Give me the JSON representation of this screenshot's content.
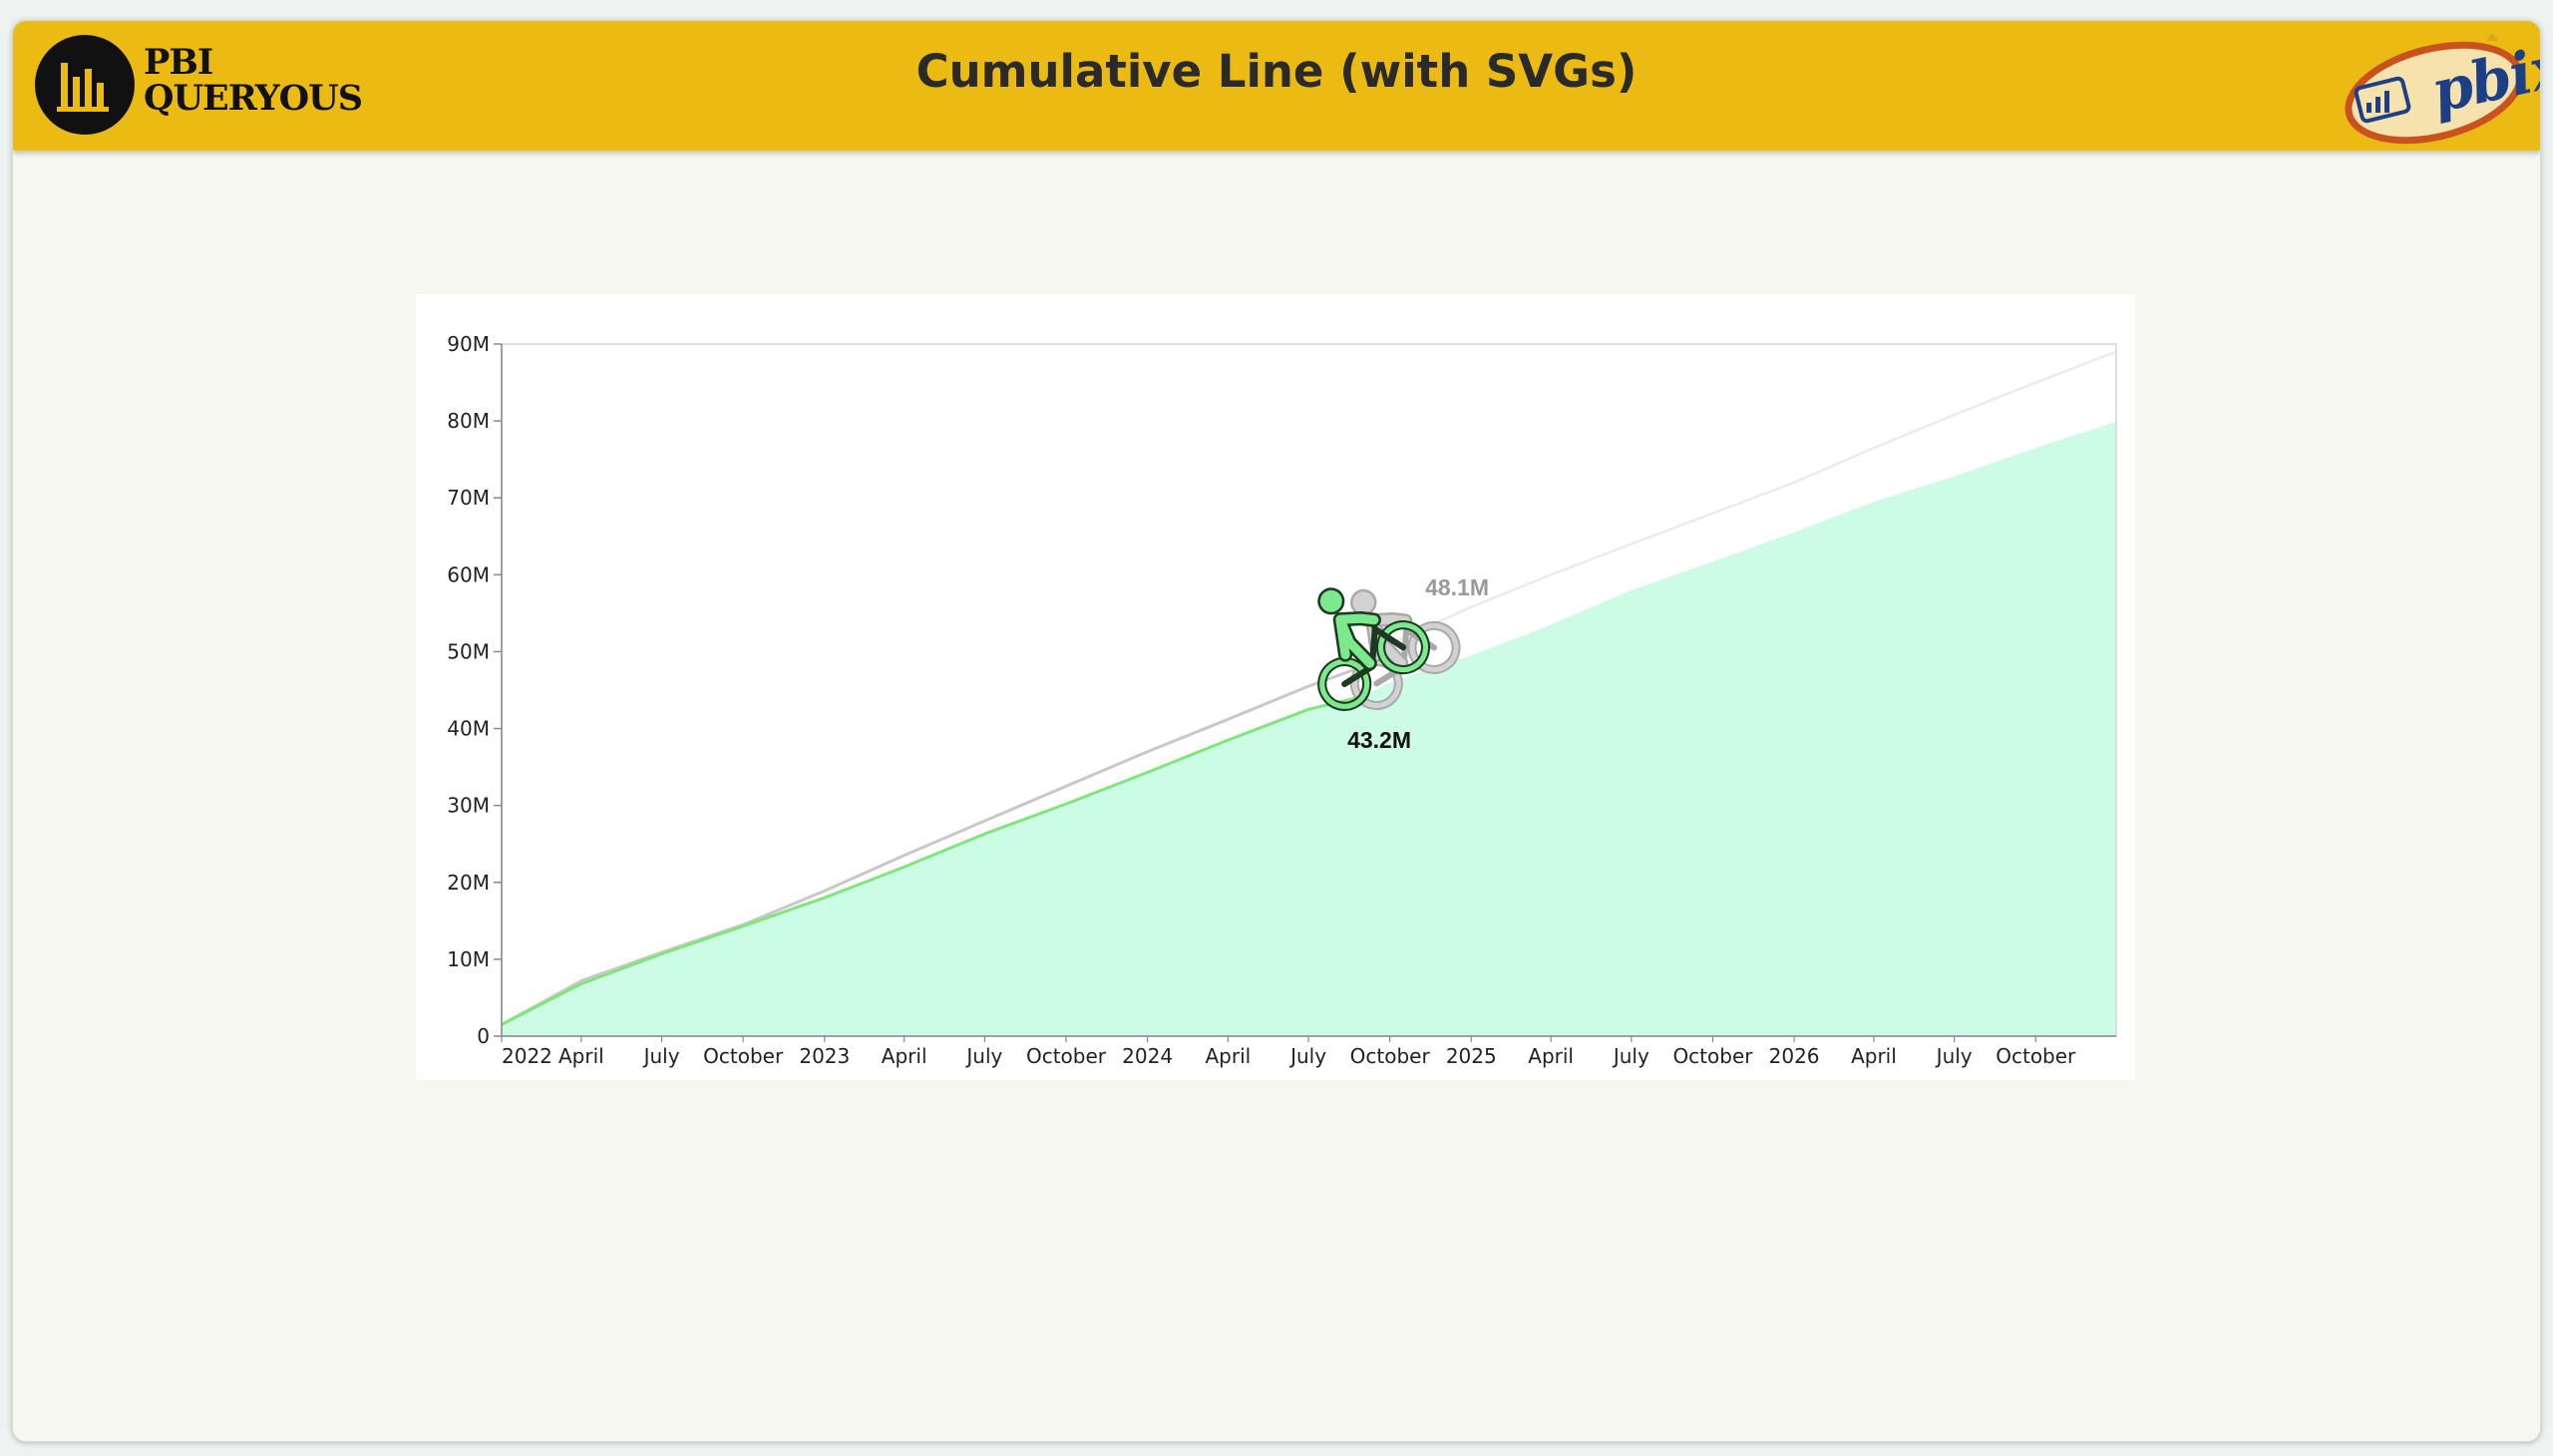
{
  "header": {
    "brand_line1": "PBI",
    "brand_line2": "QUERYOUS",
    "title": "Cumulative Line (with SVGs)",
    "badge_text": "pbix"
  },
  "colors": {
    "header_bg": "#ebbb14",
    "current_fill": "#ccfce6",
    "current_line": "#80e67a",
    "comparison_line": "#c8c8c8",
    "comparison_line_light": "#ebebeb",
    "current_label": "#111111",
    "comparison_label": "#9a9a9a",
    "rider_green": "#7ee88f"
  },
  "icons": [
    "bar-chart-logo-icon",
    "pbix-badge-icon",
    "bike-rider-icon"
  ],
  "chart_data": {
    "type": "area",
    "title": "",
    "xlabel": "",
    "ylabel": "",
    "ylim": [
      0,
      90000000
    ],
    "y_ticks": [
      "90M",
      "80M",
      "70M",
      "60M",
      "50M",
      "40M",
      "30M",
      "20M",
      "10M",
      "0"
    ],
    "x_ticks": [
      "2022",
      "April",
      "July",
      "October",
      "2023",
      "April",
      "July",
      "October",
      "2024",
      "April",
      "July",
      "October",
      "2025",
      "April",
      "July",
      "October",
      "2026",
      "April",
      "July",
      "October"
    ],
    "x_range": [
      "2022-01-01",
      "2026-12-31"
    ],
    "series": [
      {
        "role": "current",
        "style": "area",
        "x": [
          "2022-01-01",
          "2022-04-01",
          "2022-07-01",
          "2022-10-01",
          "2023-01-01",
          "2023-04-01",
          "2023-07-01",
          "2023-10-01",
          "2024-01-01",
          "2024-04-01",
          "2024-07-01",
          "2024-09-01",
          "2024-10-01",
          "2025-01-01",
          "2025-04-01",
          "2025-07-01",
          "2025-10-01",
          "2026-01-01",
          "2026-04-01",
          "2026-07-01",
          "2026-10-01",
          "2026-12-31"
        ],
        "values": [
          1500000,
          6800000,
          10700000,
          14300000,
          18000000,
          22000000,
          26300000,
          30200000,
          34300000,
          38500000,
          42500000,
          44200000,
          46000000,
          49500000,
          53500000,
          58000000,
          61700000,
          65500000,
          69500000,
          72800000,
          76500000,
          79900000
        ]
      },
      {
        "role": "comparison",
        "style": "line",
        "x": [
          "2022-01-01",
          "2022-04-01",
          "2022-07-01",
          "2022-10-01",
          "2023-01-01",
          "2023-04-01",
          "2023-07-01",
          "2023-10-01",
          "2024-01-01",
          "2024-04-01",
          "2024-07-01",
          "2024-09-01",
          "2024-10-01",
          "2025-01-01",
          "2025-04-01",
          "2025-07-01",
          "2025-10-01",
          "2026-01-01",
          "2026-04-01",
          "2026-07-01",
          "2026-10-01",
          "2026-12-31"
        ],
        "values": [
          1500000,
          7200000,
          10900000,
          14500000,
          18900000,
          23500000,
          28000000,
          32500000,
          37000000,
          41200000,
          45500000,
          48100000,
          51000000,
          55800000,
          60000000,
          64000000,
          68000000,
          72000000,
          76500000,
          80800000,
          85000000,
          89000000
        ]
      }
    ],
    "markers": [
      {
        "role": "current",
        "x": "2024-09-01",
        "value": 43200000,
        "label": "43.2M"
      },
      {
        "role": "comparison",
        "x": "2024-09-01",
        "value": 48100000,
        "label": "48.1M"
      }
    ]
  }
}
